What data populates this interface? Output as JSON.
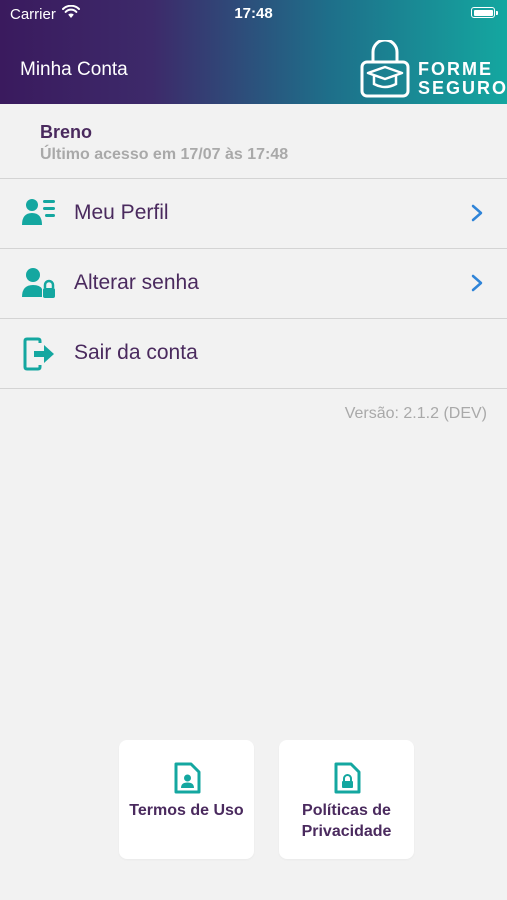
{
  "status_bar": {
    "carrier": "Carrier",
    "time": "17:48"
  },
  "header": {
    "title": "Minha Conta",
    "logo_line1": "FORME",
    "logo_line2": "SEGURO"
  },
  "user": {
    "name": "Breno",
    "last_access": "Último acesso em 17/07 às 17:48"
  },
  "menu": [
    {
      "label": "Meu Perfil",
      "icon": "profile-list-icon"
    },
    {
      "label": "Alterar senha",
      "icon": "user-lock-icon"
    },
    {
      "label": "Sair da conta",
      "icon": "logout-icon"
    }
  ],
  "version": "Versão: 2.1.2 (DEV)",
  "cards": [
    {
      "label": "Termos de Uso",
      "icon": "document-user-icon"
    },
    {
      "label": "Políticas de Privacidade",
      "icon": "document-lock-icon"
    }
  ],
  "colors": {
    "accent": "#14a7a0",
    "primary_text": "#4a2a5e",
    "chevron": "#2f84d8",
    "header_start": "#3a1a5e",
    "header_end": "#14a7a0"
  }
}
